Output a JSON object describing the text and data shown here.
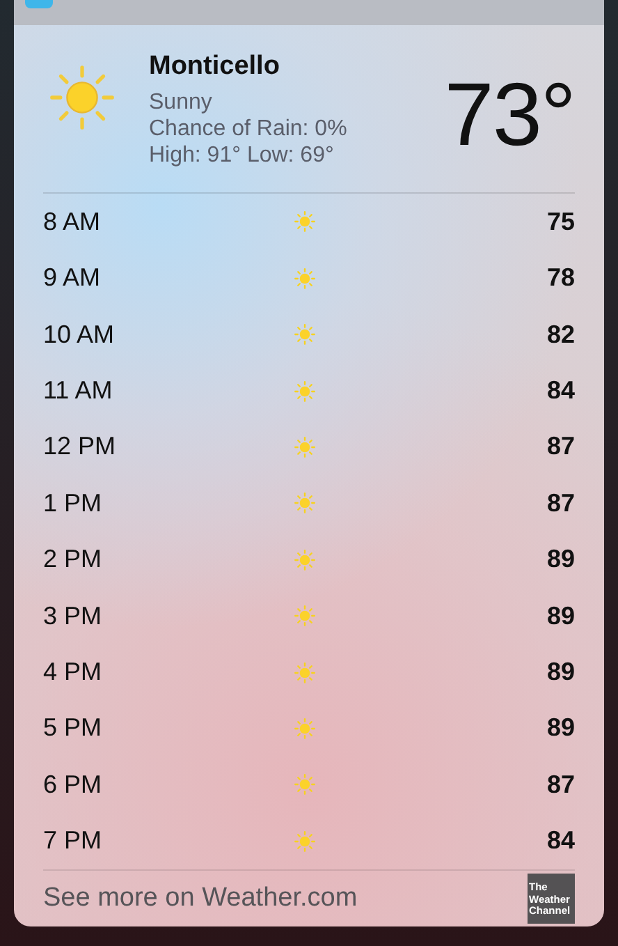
{
  "current": {
    "city": "Monticello",
    "condition": "Sunny",
    "rain": "Chance of Rain: 0%",
    "high_low": "High: 91° Low: 69°",
    "temperature": "73°"
  },
  "hourly": [
    {
      "time": "8 AM",
      "temp": "75"
    },
    {
      "time": "9 AM",
      "temp": "78"
    },
    {
      "time": "10 AM",
      "temp": "82"
    },
    {
      "time": "11 AM",
      "temp": "84"
    },
    {
      "time": "12 PM",
      "temp": "87"
    },
    {
      "time": "1 PM",
      "temp": "87"
    },
    {
      "time": "2 PM",
      "temp": "89"
    },
    {
      "time": "3 PM",
      "temp": "89"
    },
    {
      "time": "4 PM",
      "temp": "89"
    },
    {
      "time": "5 PM",
      "temp": "89"
    },
    {
      "time": "6 PM",
      "temp": "87"
    },
    {
      "time": "7 PM",
      "temp": "84"
    }
  ],
  "footer": {
    "link": "See more on Weather.com",
    "logo_lines": [
      "The",
      "Weather",
      "Channel"
    ]
  }
}
